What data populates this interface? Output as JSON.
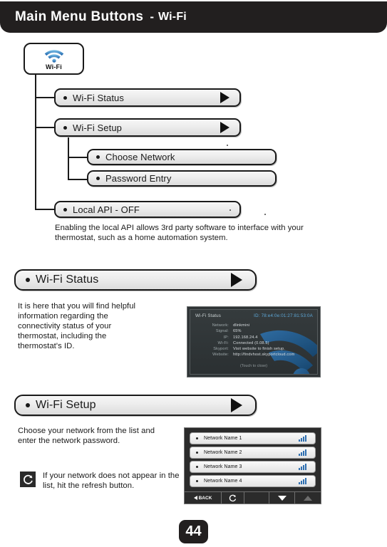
{
  "header": {
    "title": "Main Menu Buttons",
    "separator": "-",
    "subtitle": "Wi-Fi"
  },
  "root_button": {
    "label": "Wi-Fi",
    "icon": "wifi-icon"
  },
  "tree": {
    "items": [
      {
        "label": "Wi-Fi Status",
        "has_arrow": true,
        "level": 1
      },
      {
        "label": "Wi-Fi Setup",
        "has_arrow": true,
        "level": 1
      },
      {
        "label": "Choose Network",
        "has_arrow": false,
        "level": 2
      },
      {
        "label": "Password Entry",
        "has_arrow": false,
        "level": 2
      },
      {
        "label": "Local API - OFF",
        "has_arrow": false,
        "level": 1
      }
    ],
    "note": "Enabling the local API allows 3rd party software to interface with your thermostat, such as a home automation system."
  },
  "status_section": {
    "heading": "Wi-Fi Status",
    "body": "It is here that you will find helpful information regarding the connectivity status of your thermostat, including the thermostat's ID.",
    "device": {
      "screen_title": "Wi-Fi Status",
      "id_label": "ID:",
      "id_value": "78:e4:0e:01:27:81:53:0A",
      "rows": [
        {
          "key": "Network:",
          "value": "dlinkmini"
        },
        {
          "key": "Signal:",
          "value": "65%"
        },
        {
          "key": "IP:",
          "value": "192.168.24.4"
        },
        {
          "key": "Wi-Fi:",
          "value": "Connected (0.08.5)"
        },
        {
          "key": "Skyport:",
          "value": "Visit website to finish setup."
        },
        {
          "key": "Website:",
          "value": "http://findvhost.skyportcloud.com"
        }
      ],
      "footer": "(Touch to close)"
    }
  },
  "setup_section": {
    "heading": "Wi-Fi Setup",
    "body": "Choose your network from the list and enter the network password.",
    "refresh_note": "If your network does not appear in the list, hit the refresh button.",
    "refresh_icon": "refresh-icon",
    "device": {
      "networks": [
        "Network Name 1",
        "Network Name 2",
        "Network Name 3",
        "Network Name 4"
      ],
      "toolbar": {
        "back_label": "BACK",
        "refresh_icon": "refresh-icon",
        "scroll_down_icon": "triangle-down-icon",
        "scroll_up_icon": "triangle-up-icon"
      }
    }
  },
  "footer": {
    "page_number": "44"
  },
  "colors": {
    "header_bg": "#221f1f",
    "wifi_blue": "#2f7fc0",
    "signal_bar": "#2f6fb0",
    "device_bg": "#2b2b2b"
  }
}
